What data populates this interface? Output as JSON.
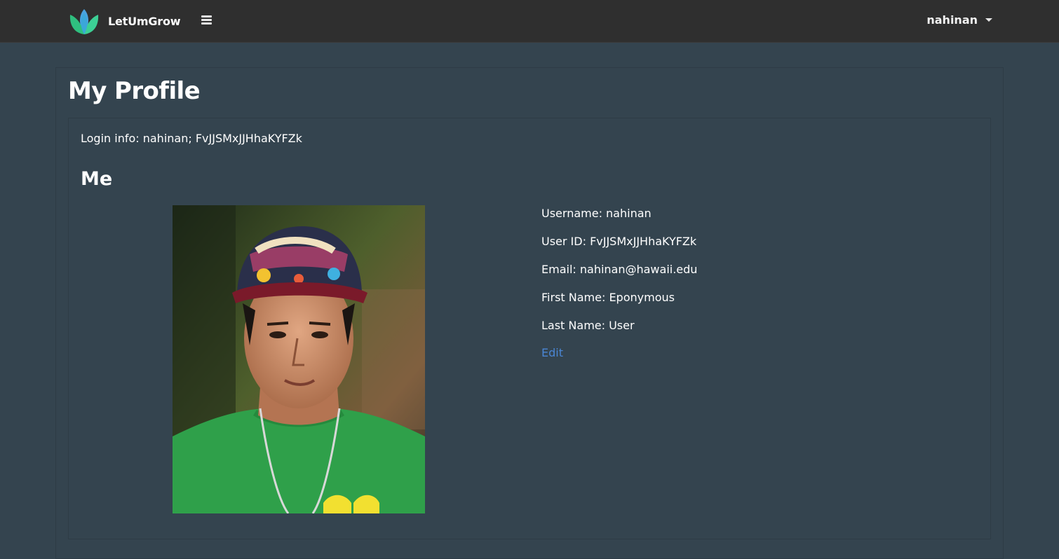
{
  "navbar": {
    "brand_name": "LetUmGrow",
    "logo_icon": "lotus-leaf-icon",
    "menu_icon": "hamburger-icon",
    "user_name": "nahinan",
    "dropdown_icon": "caret-down-icon"
  },
  "page": {
    "title": "My Profile"
  },
  "profile": {
    "login_info": "Login info: nahinan; FvJJSMxJJHhaKYFZk",
    "section_heading": "Me",
    "photo_alt": "Profile photo",
    "details": [
      "Username: nahinan",
      "User ID: FvJJSMxJJHhaKYFZk",
      "Email: nahinan@hawaii.edu",
      "First Name: Eponymous",
      "Last Name: User"
    ],
    "edit_label": "Edit"
  },
  "colors": {
    "navbar_bg": "#2f2f2f",
    "page_bg": "#34444f",
    "link": "#4a86d4",
    "logo_green": "#35c98a",
    "logo_blue": "#3d8fd9"
  }
}
